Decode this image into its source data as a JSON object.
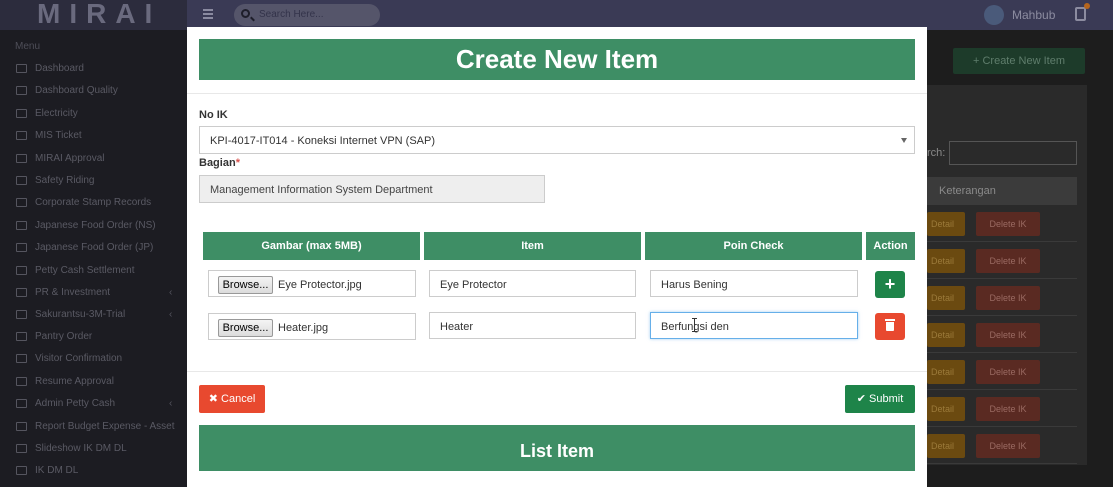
{
  "app": {
    "brand": "MIRAI",
    "search_placeholder": "Search Here...",
    "user_name": "Mahbub"
  },
  "sidebar": {
    "header": "Menu",
    "items": [
      {
        "label": "Dashboard",
        "icon": "monitor-icon",
        "chevron": false
      },
      {
        "label": "Dashboard Quality",
        "icon": "monitor-icon",
        "chevron": false
      },
      {
        "label": "Electricity",
        "icon": "monitor-icon",
        "chevron": false
      },
      {
        "label": "MIS Ticket",
        "icon": "edit-icon",
        "chevron": false
      },
      {
        "label": "MIRAI Approval",
        "icon": "edit-icon",
        "chevron": false
      },
      {
        "label": "Safety Riding",
        "icon": "edit-icon",
        "chevron": false
      },
      {
        "label": "Corporate Stamp Records",
        "icon": "edit-icon",
        "chevron": false
      },
      {
        "label": "Japanese Food Order (NS)",
        "icon": "edit-icon",
        "chevron": false
      },
      {
        "label": "Japanese Food Order (JP)",
        "icon": "edit-icon",
        "chevron": false
      },
      {
        "label": "Petty Cash Settlement",
        "icon": "edit-icon",
        "chevron": false
      },
      {
        "label": "PR & Investment",
        "icon": "edit-icon",
        "chevron": true
      },
      {
        "label": "Sakurantsu-3M-Trial",
        "icon": "edit-icon",
        "chevron": true
      },
      {
        "label": "Pantry Order",
        "icon": "edit-icon",
        "chevron": false
      },
      {
        "label": "Visitor Confirmation",
        "icon": "list-icon",
        "chevron": false
      },
      {
        "label": "Resume Approval",
        "icon": "list-icon",
        "chevron": false
      },
      {
        "label": "Admin Petty Cash",
        "icon": "edit-icon",
        "chevron": true
      },
      {
        "label": "Report Budget Expense - Asset",
        "icon": "list-icon",
        "chevron": false
      },
      {
        "label": "Slideshow IK DM DL",
        "icon": "monitor-icon",
        "chevron": false
      },
      {
        "label": "IK DM DL",
        "icon": "list-icon",
        "chevron": false
      }
    ]
  },
  "background_page": {
    "create_button": "+ Create New Item",
    "search_label": "rch:",
    "column_header": "Keterangan",
    "detail_label": "Detail",
    "delete_label": "Delete IK",
    "row_count": 7
  },
  "modal": {
    "title": "Create New Item",
    "no_ik_label": "No IK",
    "no_ik_value": "KPI-4017-IT014 - Koneksi Internet VPN (SAP)",
    "bagian_label": "Bagian",
    "bagian_required_mark": "*",
    "bagian_value": "Management Information System Department",
    "table": {
      "headers": [
        "Gambar (max 5MB)",
        "Item",
        "Poin Check",
        "Action"
      ],
      "browse_label": "Browse...",
      "rows": [
        {
          "file": "Eye Protector.jpg",
          "item": "Eye Protector",
          "poin_check": "Harus Bening",
          "action": "add"
        },
        {
          "file": "Heater.jpg",
          "item": "Heater",
          "poin_check": "Berfungsi den",
          "action": "delete"
        }
      ]
    },
    "cancel_label": "Cancel",
    "submit_label": "Submit",
    "list_title": "List Item"
  }
}
